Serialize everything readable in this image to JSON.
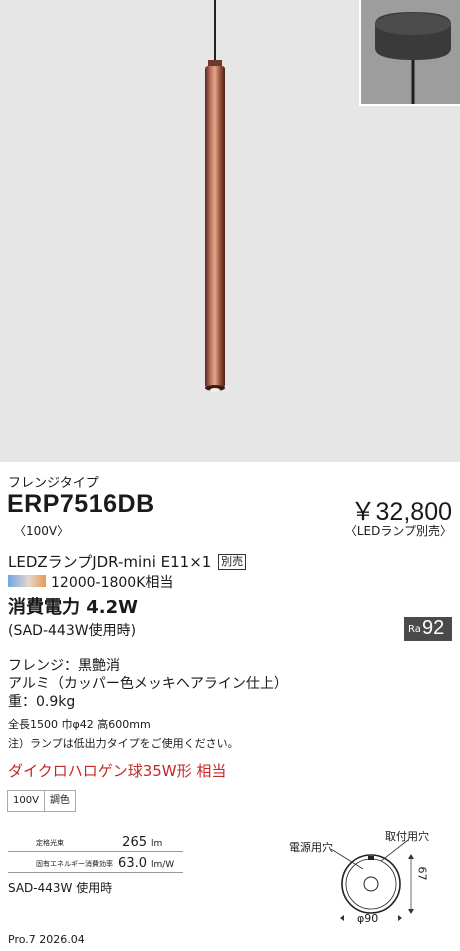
{
  "product": {
    "mount_type": "フレンジタイプ",
    "model": "ERP7516DB",
    "voltage_note": "〈100V〉",
    "price": "￥32,800",
    "lamp_sold_note": "〈LEDランプ別売〉"
  },
  "lamp": {
    "name": "LEDZランプJDR-mini  E11×1",
    "sold_separately": "別売",
    "color_temp": "12000-1800K相当",
    "power": "消費電力 4.2W",
    "power_condition": "(SAD-443W使用時)",
    "ra_label": "Ra",
    "ra_value": "92"
  },
  "materials": {
    "flange": "フレンジ：黒艶消",
    "aluminum": "アルミ（カッパー色メッキヘアライン仕上）",
    "weight": "重：0.9kg",
    "dimensions": "全長1500 巾φ42 高600mm",
    "note": "注）ランプは低出力タイプをご使用ください。",
    "halogen_equiv": "ダイクロハロゲン球35W形 相当"
  },
  "tags": [
    "100V",
    "調色"
  ],
  "specs": [
    {
      "label": "定格光束",
      "value": "265",
      "unit": "lm"
    },
    {
      "label": "固有エネルギー消費効率",
      "value": "63.0",
      "unit": "lm/W"
    }
  ],
  "spec_condition": "SAD-443W 使用時",
  "diagram": {
    "power_hole": "電源用穴",
    "mount_hole": "取付用穴",
    "height": "67",
    "diameter": "φ90"
  },
  "footer": "Pro.7 2026.04"
}
